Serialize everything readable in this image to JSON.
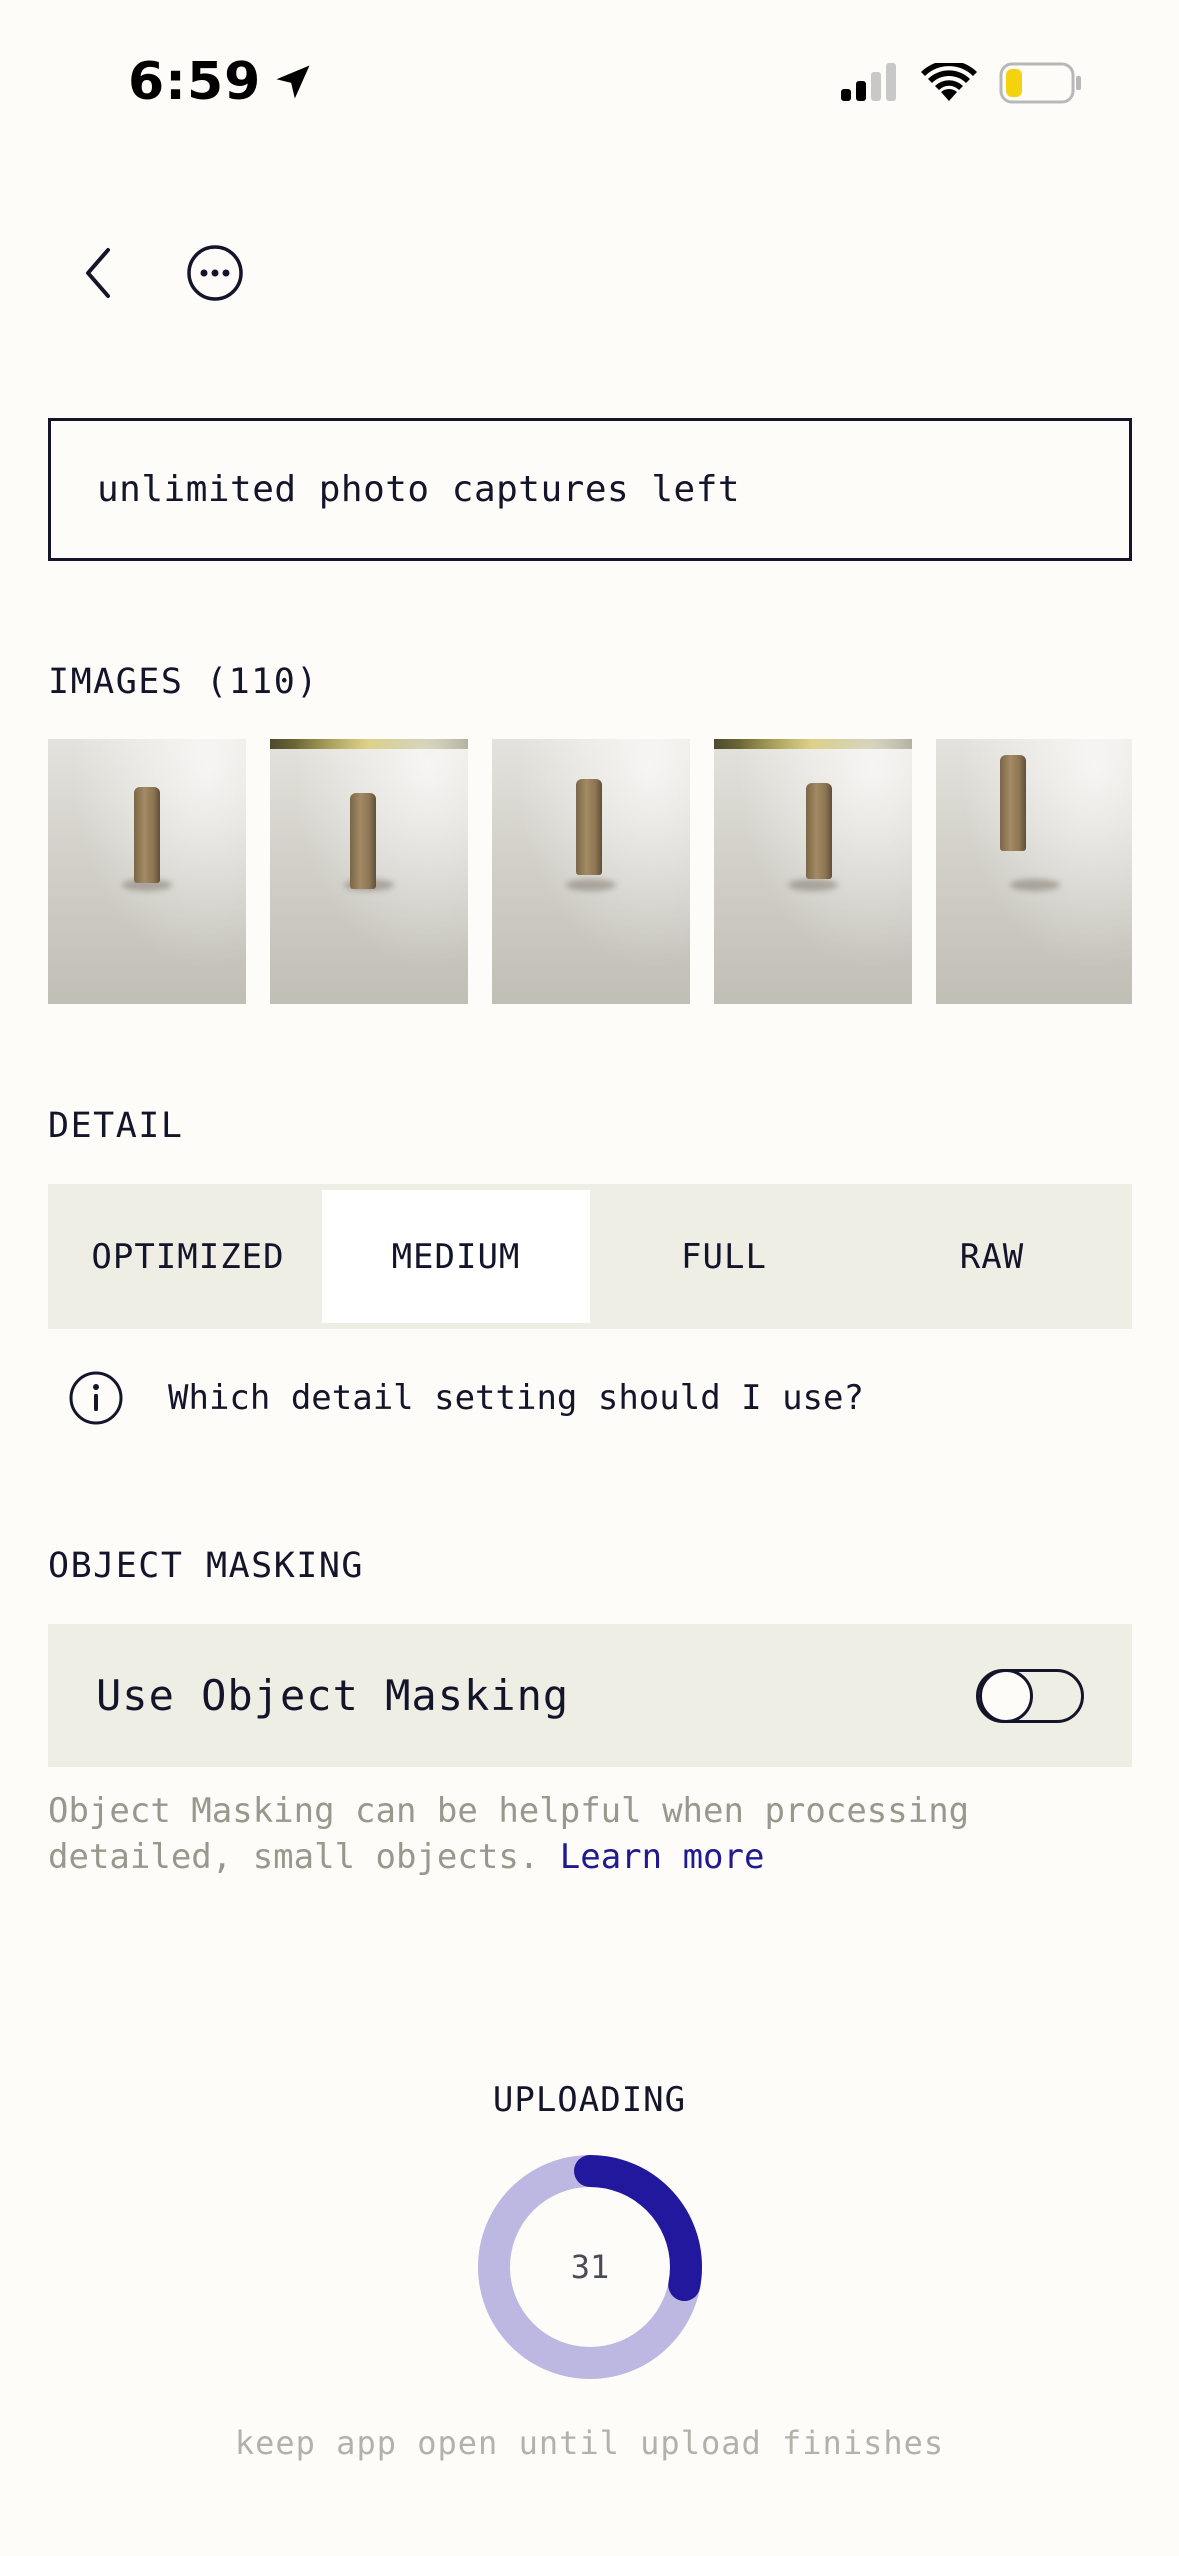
{
  "status_bar": {
    "time": "6:59",
    "icons": [
      "location-arrow-icon",
      "cellular-signal-icon",
      "wifi-icon",
      "battery-icon"
    ],
    "battery_color": "#F5D20E"
  },
  "header": {
    "back_icon": "chevron-left-icon",
    "more_icon": "ellipsis-circle-icon"
  },
  "captures": {
    "text": "unlimited photo captures left"
  },
  "images": {
    "label": "IMAGES (110)",
    "thumbnails": [
      "photo-1",
      "photo-2",
      "photo-3",
      "photo-4",
      "photo-5"
    ]
  },
  "detail": {
    "label": "DETAIL",
    "options": [
      "OPTIMIZED",
      "MEDIUM",
      "FULL",
      "RAW"
    ],
    "selected": "MEDIUM",
    "help_text": "Which detail setting should I use?"
  },
  "masking": {
    "label": "OBJECT MASKING",
    "toggle_label": "Use Object Masking",
    "toggle_on": false,
    "note": "Object Masking can be helpful when processing detailed, small objects.",
    "link_text": "Learn more"
  },
  "upload": {
    "label": "UPLOADING",
    "progress_text": "31",
    "progress_fraction": 0.28,
    "note": "keep app open until upload finishes",
    "colors": {
      "track": "#BDB8E2",
      "fill": "#22189E"
    }
  }
}
